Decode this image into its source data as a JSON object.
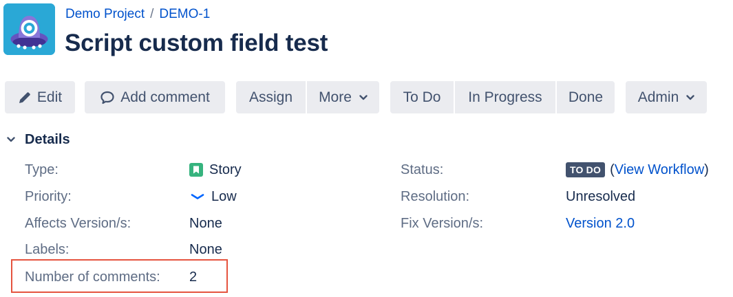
{
  "header": {
    "project_link": "Demo Project",
    "separator": "/",
    "issue_key": "DEMO-1",
    "title": "Script custom field test",
    "avatar_icon": "project-avatar-icon"
  },
  "toolbar": {
    "edit_label": "Edit",
    "edit_icon": "pencil-icon",
    "add_comment_label": "Add comment",
    "add_comment_icon": "comment-icon",
    "assign_label": "Assign",
    "more_label": "More",
    "todo_label": "To Do",
    "in_progress_label": "In Progress",
    "done_label": "Done",
    "admin_label": "Admin",
    "button_bg": "#ebecf0",
    "button_text_color": "#42526e"
  },
  "details": {
    "heading": "Details",
    "left": [
      {
        "label": "Type:",
        "value": "Story",
        "icon": "story-icon",
        "icon_color": "#36b37e"
      },
      {
        "label": "Priority:",
        "value": "Low",
        "icon": "priority-low-icon",
        "icon_color": "#0065ff"
      },
      {
        "label": "Affects Version/s:",
        "value": "None"
      },
      {
        "label": "Labels:",
        "value": "None"
      },
      {
        "label": "Number of comments:",
        "value": "2"
      }
    ],
    "right": [
      {
        "label": "Status:",
        "lozenge": "TO DO",
        "paren_open": "(",
        "link": "View Workflow",
        "paren_close": ")"
      },
      {
        "label": "Resolution:",
        "value": "Unresolved"
      },
      {
        "label": "Fix Version/s:",
        "value": "Version 2.0"
      }
    ]
  },
  "colors": {
    "link": "#0052cc",
    "title": "#172b4d",
    "label": "#5e6c84",
    "lozenge_bg": "#42526e",
    "highlight": "#e5533e",
    "avatar_bg": "#2aa8d6"
  }
}
